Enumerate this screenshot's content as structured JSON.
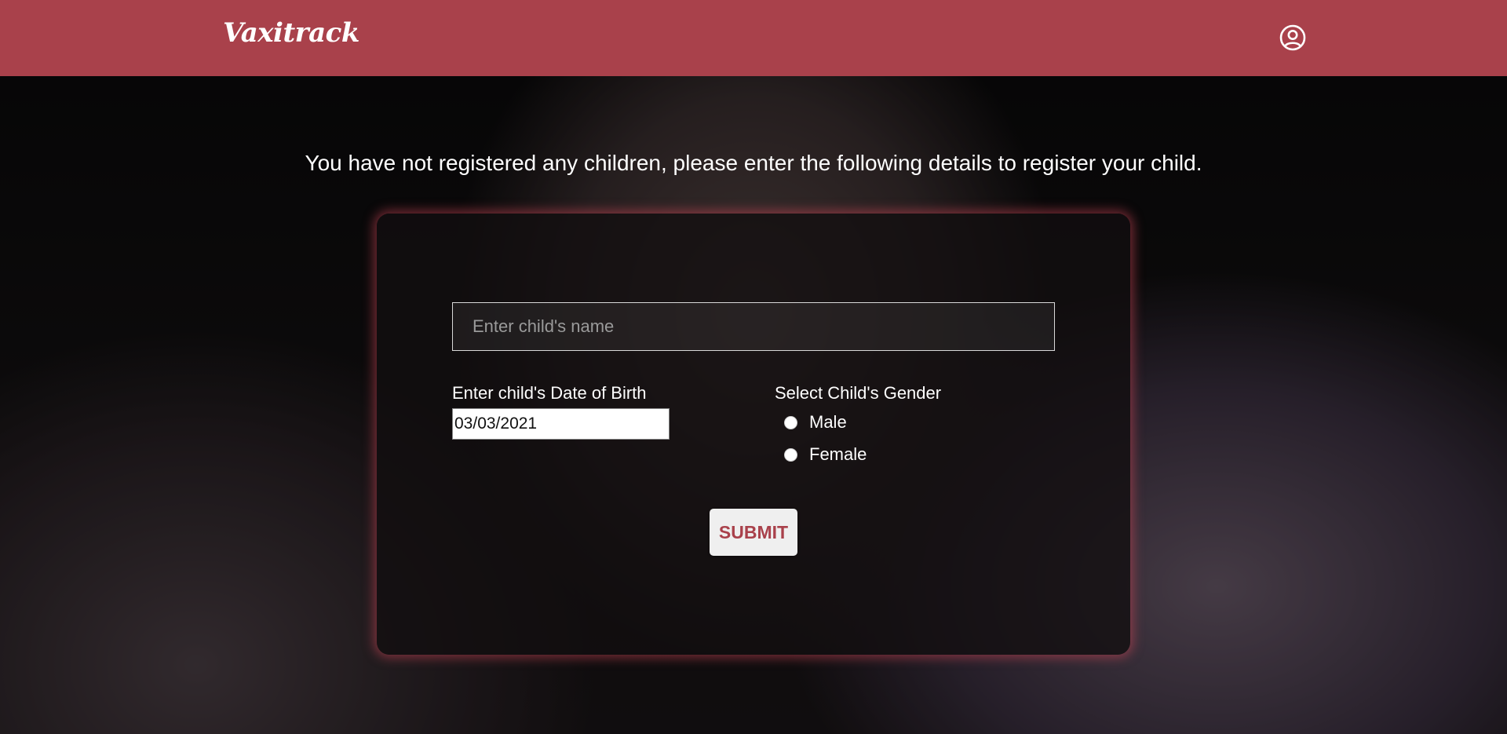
{
  "header": {
    "brand": "Vaxitrack",
    "profile_icon": "user-circle-icon",
    "bg_color": "#a9414b"
  },
  "main": {
    "intro_text": "You have not registered any children, please enter the following details to register your child."
  },
  "form": {
    "name_placeholder": "Enter child's name",
    "name_value": "",
    "dob_label": "Enter child's Date of Birth",
    "dob_value": "03/03/2021",
    "gender_label": "Select Child's Gender",
    "gender_options": [
      {
        "label": "Male",
        "selected": false
      },
      {
        "label": "Female",
        "selected": false
      }
    ],
    "submit_label": "SUBMIT"
  },
  "colors": {
    "accent": "#a9414b",
    "card_glow": "#c84655"
  }
}
